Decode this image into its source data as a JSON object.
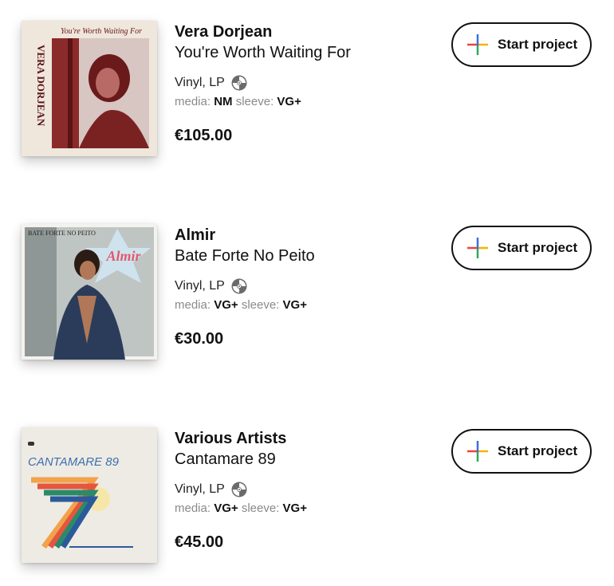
{
  "button_label": "Start project",
  "colors": {
    "plus_red": "#e8453c",
    "plus_blue": "#3b6fe0",
    "plus_green": "#2eaa5a",
    "plus_yellow": "#f5b400"
  },
  "items": [
    {
      "artist": "Vera Dorjean",
      "title": "You're Worth Waiting For",
      "format": "Vinyl, LP",
      "media_label": "media:",
      "media_grade": "NM",
      "sleeve_label": "sleeve:",
      "sleeve_grade": "VG+",
      "price": "€105.00",
      "cover_text": "You're Worth Waiting For",
      "cover_spine": "VERA DORJEAN"
    },
    {
      "artist": "Almir",
      "title": "Bate Forte No Peito",
      "format": "Vinyl, LP",
      "media_label": "media:",
      "media_grade": "VG+",
      "sleeve_label": "sleeve:",
      "sleeve_grade": "VG+",
      "price": "€30.00",
      "cover_text": "BATE FORTE NO PEITO",
      "cover_logo": "Almir"
    },
    {
      "artist": "Various Artists",
      "title": "Cantamare 89",
      "format": "Vinyl, LP",
      "media_label": "media:",
      "media_grade": "VG+",
      "sleeve_label": "sleeve:",
      "sleeve_grade": "VG+",
      "price": "€45.00",
      "cover_text": "CANTAMARE 89"
    }
  ]
}
